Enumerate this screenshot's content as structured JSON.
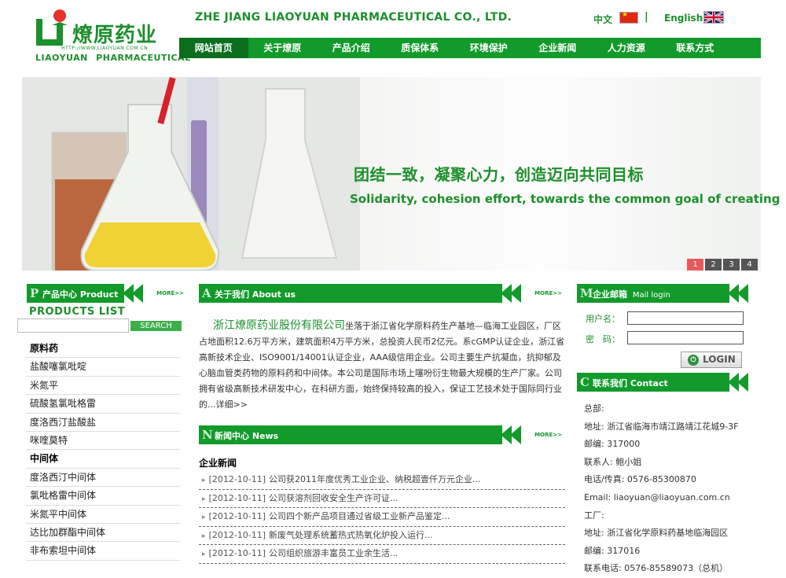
{
  "header": {
    "logo_cn": "燎原药业",
    "logo_url": "HTTP://WWW.LIAOYUAN.COM.CN",
    "logo_en": "LIAOYUAN PHARMACEUTICAL",
    "company_en": "ZHE JIANG LIAOYUAN PHARMACEUTICAL CO., LTD.",
    "lang_cn": "中文",
    "lang_sep": "|",
    "lang_en": "English"
  },
  "nav": [
    "网站首页",
    "关于燎原",
    "产品介绍",
    "质保体系",
    "环境保护",
    "企业新闻",
    "人力资源",
    "联系方式"
  ],
  "banner": {
    "slogan_cn": "团结一致，凝聚心力，创造迈向共同目标",
    "slogan_en": "Solidarity, cohesion effort, towards the common goal of creating",
    "pages": [
      "1",
      "2",
      "3",
      "4"
    ]
  },
  "products": {
    "letter": "P",
    "title": "产品中心 Product",
    "more": "MORE>>",
    "list_title": "PRODUCTS LIST",
    "search_btn": "SEARCH",
    "items": [
      {
        "label": "原料药",
        "cat": true
      },
      {
        "label": "盐酸噻氯吡啶",
        "cat": false
      },
      {
        "label": "米氮平",
        "cat": false
      },
      {
        "label": "硫酸氢氯吡格雷",
        "cat": false
      },
      {
        "label": "度洛西汀盐酸盐",
        "cat": false
      },
      {
        "label": "咪喹莫特",
        "cat": false
      },
      {
        "label": "中间体",
        "cat": true
      },
      {
        "label": "度洛西汀中间体",
        "cat": false
      },
      {
        "label": "氯吡格雷中间体",
        "cat": false
      },
      {
        "label": "米氮平中间体",
        "cat": false
      },
      {
        "label": "达比加群酯中间体",
        "cat": false
      },
      {
        "label": "非布索坦中间体",
        "cat": false
      }
    ]
  },
  "about": {
    "letter": "A",
    "title": "关于我们 About us",
    "more": "MORE>>",
    "company": "浙江燎原药业股份有限公司",
    "body": "坐落于浙江省化学原料药生产基地—临海工业园区，厂区占地面积12.6万平方米，建筑面积4万平方米，总投资人民币2亿元。系cGMP认证企业，浙江省高新技术企业、ISO9001/14001认证企业，AAA级信用企业。公司主要生产抗凝血，抗抑郁及心脑血管类药物的原料药和中间体。本公司是国际市场上噻吩衍生物最大规模的生产厂家。公司拥有省级高新技术研发中心，在科研方面，始终保持较高的投入，保证工艺技术处于国际同行业的...",
    "detail": "详细>>"
  },
  "news": {
    "letter": "N",
    "title": "新闻中心 News",
    "more": "MORE>>",
    "category": "企业新闻",
    "items": [
      {
        "date": "[2012-10-11]",
        "title": "公司获2011年度优秀工业企业、纳税超壹仟万元企业..."
      },
      {
        "date": "[2012-10-11]",
        "title": "公司获溶剂回收安全生产许可证..."
      },
      {
        "date": "[2012-10-11]",
        "title": "公司四个新产品项目通过省级工业新产品鉴定..."
      },
      {
        "date": "[2012-10-11]",
        "title": "新废气处理系统蓄热式热氧化炉投入运行..."
      },
      {
        "date": "[2012-10-11]",
        "title": "公司组织旅游丰富员工业余生活..."
      }
    ]
  },
  "mail": {
    "letter": "M",
    "title": "企业邮箱",
    "title_small": "Mail login",
    "user_label": "用户名：",
    "pass_label": "密　码：",
    "login": "LOGIN"
  },
  "contact": {
    "letter": "C",
    "title": "联系我们 Contact",
    "lines": [
      "总部:",
      "地址: 浙江省临海市靖江路靖江花城9-3F",
      "邮编: 317000",
      "联系人: 鲍小姐",
      "电话/传真: 0576-85300870",
      "Email: liaoyuan@liaoyuan.com.cn",
      "工厂:",
      "地址: 浙江省化学原料药基地临海园区",
      "邮编: 317016",
      "联系电话: 0576-85589073（总机）"
    ]
  },
  "colors": {
    "brand_green": "#129a2b",
    "dark_green": "#0a6e1c",
    "pager_active": "#e85a5a"
  }
}
